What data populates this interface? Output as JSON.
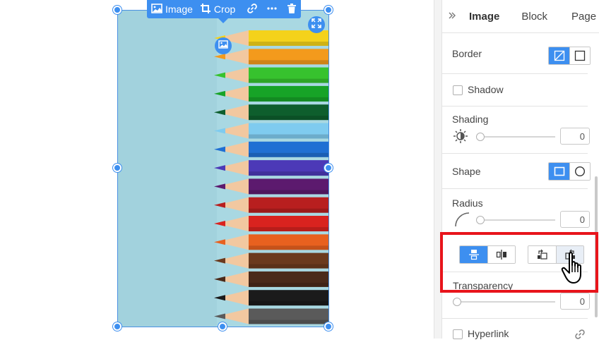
{
  "toolbar": {
    "image_label": "Image",
    "crop_label": "Crop"
  },
  "panel": {
    "tabs": [
      "Image",
      "Block",
      "Page"
    ],
    "border": {
      "label": "Border",
      "selected": "none"
    },
    "shadow": {
      "label": "Shadow",
      "checked": false
    },
    "shading": {
      "label": "Shading",
      "value": "0"
    },
    "shape": {
      "label": "Shape",
      "selected": "rectangle"
    },
    "radius": {
      "label": "Radius",
      "value": "0"
    },
    "transparency": {
      "label": "Transparency",
      "value": "0"
    },
    "hyperlink": {
      "label": "Hyperlink",
      "checked": false
    }
  },
  "colors": {
    "accent": "#3d8ff0",
    "highlight": "#e8141b",
    "image_background": "#a9d8e2"
  },
  "icons": [
    "image-icon",
    "crop-icon",
    "link-icon",
    "more-icon",
    "trash-icon",
    "expand-icon",
    "replace-image-icon",
    "collapse-icon",
    "brightness-icon",
    "radius-icon",
    "flip-vertical-icon",
    "flip-horizontal-icon",
    "rotate-left-icon",
    "rotate-right-icon",
    "hand-cursor-icon"
  ]
}
